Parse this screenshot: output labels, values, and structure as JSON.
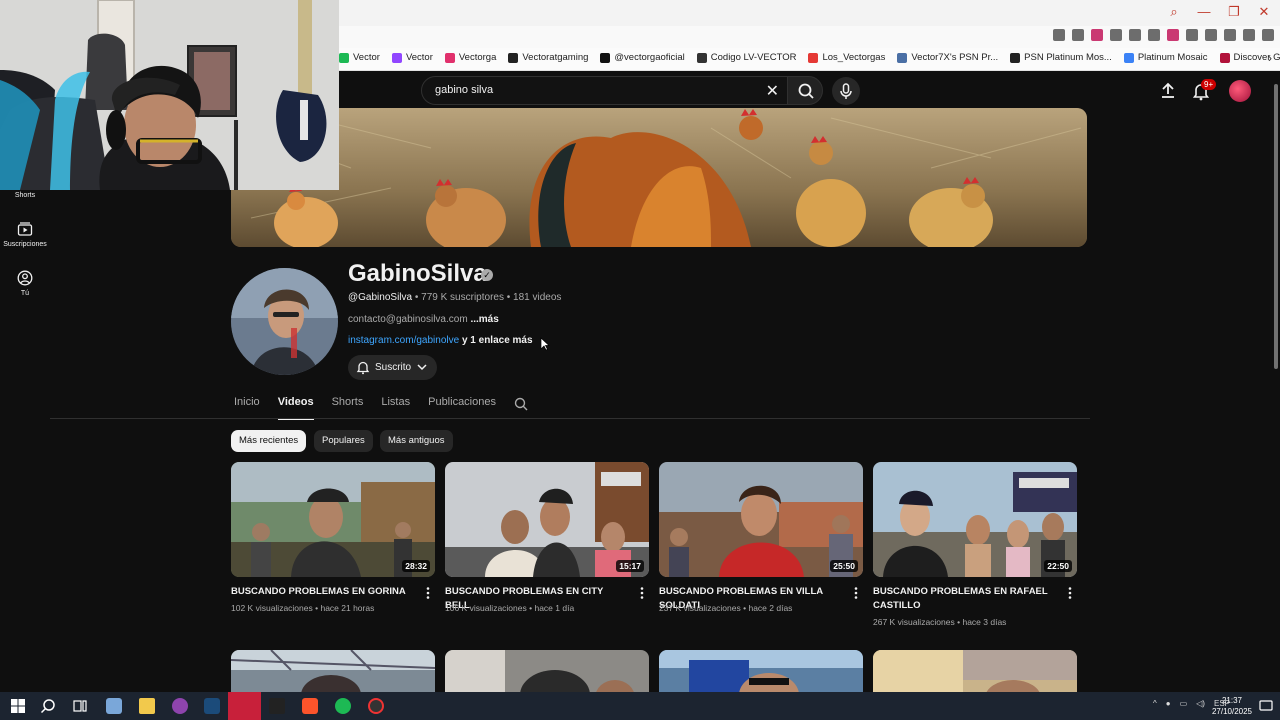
{
  "browser": {
    "bookmarks": [
      {
        "label": "Vector",
        "color": "#1db954"
      },
      {
        "label": "Vector",
        "color": "#9146ff"
      },
      {
        "label": "Vectorga",
        "color": "#e1306c"
      },
      {
        "label": "Vectoratgaming",
        "color": "#222222"
      },
      {
        "label": "@vectorgaoficial",
        "color": "#111111"
      },
      {
        "label": "Codigo LV-VECTOR",
        "color": "#333333"
      },
      {
        "label": "Los_Vectorgas",
        "color": "#e53935"
      },
      {
        "label": "Vector7X's PSN Pr...",
        "color": "#4a6fa5"
      },
      {
        "label": "PSN Platinum Mos...",
        "color": "#222222"
      },
      {
        "label": "Platinum Mosaic",
        "color": "#3b82f6"
      },
      {
        "label": "Discover Games -...",
        "color": "#b1123a"
      }
    ]
  },
  "search": {
    "query": "gabino silva"
  },
  "notifications": {
    "badge": "9+"
  },
  "sidebar": {
    "items": [
      {
        "label": "Shorts"
      },
      {
        "label": "Suscripciones"
      },
      {
        "label": "Tú"
      }
    ]
  },
  "channel": {
    "name": "GabinoSilva",
    "handle": "@GabinoSilva",
    "subscribers": "779 K suscriptores",
    "video_count": "181 videos",
    "description": "contacto@gabinosilva.com",
    "more": "...más",
    "link": "instagram.com/gabinolve",
    "link_extra": "y 1 enlace más",
    "subscribe_label": "Suscrito"
  },
  "tabs": [
    "Inicio",
    "Videos",
    "Shorts",
    "Listas",
    "Publicaciones"
  ],
  "active_tab": "Videos",
  "chips": [
    "Más recientes",
    "Populares",
    "Más antiguos"
  ],
  "videos": [
    {
      "title": "BUSCANDO PROBLEMAS EN GORINA",
      "views": "102 K visualizaciones",
      "age": "hace 21 horas",
      "duration": "28:32"
    },
    {
      "title": "BUSCANDO PROBLEMAS EN CITY BELL",
      "views": "106 K visualizaciones",
      "age": "hace 1 día",
      "duration": "15:17"
    },
    {
      "title": "BUSCANDO PROBLEMAS EN VILLA SOLDATI",
      "views": "237 K visualizaciones",
      "age": "hace 2 días",
      "duration": "25:50"
    },
    {
      "title": "BUSCANDO PROBLEMAS EN RAFAEL CASTILLO",
      "views": "267 K visualizaciones",
      "age": "hace 3 días",
      "duration": "22:50"
    }
  ],
  "taskbar": {
    "lang": "ESP",
    "time": "21:37",
    "date": "27/10/2025"
  },
  "colors": {
    "background": "#0f0f0f",
    "link": "#3ea6ff",
    "accent_red": "#cc0000"
  }
}
